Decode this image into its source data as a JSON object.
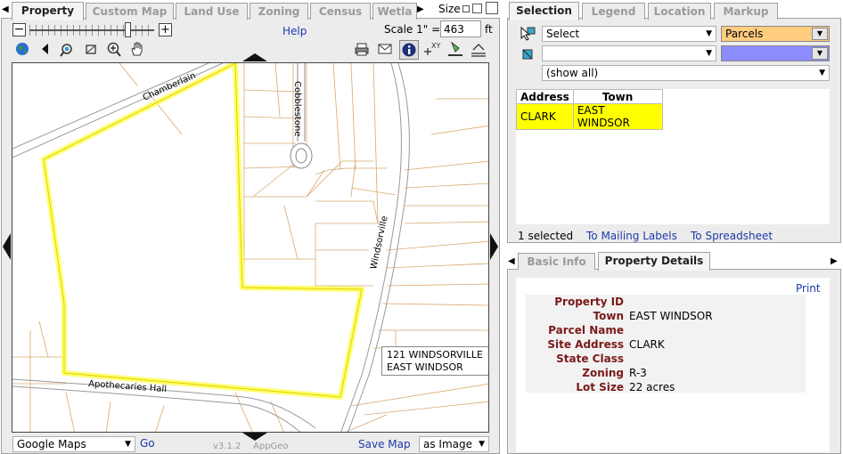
{
  "left_tabs": [
    "Property",
    "Custom Map",
    "Land Use",
    "Zoning",
    "Census",
    "Wetla"
  ],
  "size_label": "Size",
  "help_label": "Help",
  "scale": {
    "label": "Scale 1\" =",
    "value": "463",
    "unit": "ft"
  },
  "map": {
    "streets": [
      "Chamberlain",
      "Cobblestone",
      "Windsorville",
      "Apothecaries Hall"
    ],
    "popup": {
      "line1": "121 WINDSORVILLE",
      "line2": "EAST WINDSOR"
    }
  },
  "bottom_bar": {
    "basemap": "Google Maps",
    "go": "Go",
    "version": "v3.1.2",
    "brand": "AppGeo",
    "save_map": "Save Map",
    "save_format": "as Image"
  },
  "right_tabs": [
    "Selection",
    "Legend",
    "Location",
    "Markup"
  ],
  "selection": {
    "action": "Select",
    "layer": "Parcels",
    "layer_color": "#ffcc80",
    "second_layer_color": "#8c8cff",
    "filter": "(show all)",
    "table": {
      "headers": [
        "Address",
        "Town"
      ],
      "rows": [
        [
          "CLARK",
          "EAST WINDSOR"
        ]
      ]
    },
    "count": "1 selected",
    "mailing_labels": "To Mailing Labels",
    "spreadsheet": "To Spreadsheet"
  },
  "detail_tabs": [
    "Basic Info",
    "Property Details"
  ],
  "details": {
    "print": "Print",
    "fields": [
      {
        "label": "Property ID",
        "value": ""
      },
      {
        "label": "Town",
        "value": "EAST WINDSOR"
      },
      {
        "label": "Parcel Name",
        "value": ""
      },
      {
        "label": "Site Address",
        "value": "CLARK"
      },
      {
        "label": "State Class",
        "value": ""
      },
      {
        "label": "Zoning",
        "value": "R-3"
      },
      {
        "label": "Lot Size",
        "value": "22 acres"
      }
    ]
  },
  "colors": {
    "highlight": "#ffff66",
    "parcel_line": "#d9a870",
    "accent": "#1a3aa8"
  }
}
